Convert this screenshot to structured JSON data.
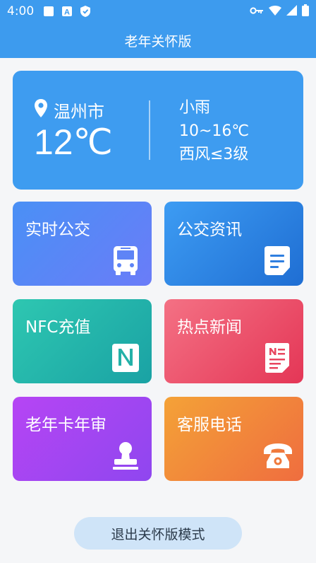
{
  "status_bar": {
    "time": "4:00",
    "icons": [
      "square-icon",
      "a-icon",
      "shield-icon",
      "key-icon",
      "wifi-icon",
      "signal-icon",
      "battery-icon"
    ]
  },
  "header": {
    "title": "老年关怀版"
  },
  "weather": {
    "city": "温州市",
    "temperature": "12℃",
    "condition": "小雨",
    "range": "10~16℃",
    "wind": "西风≤3级"
  },
  "tiles": [
    {
      "label": "实时公交",
      "icon": "bus-icon",
      "color": "#5b86f6"
    },
    {
      "label": "公交资讯",
      "icon": "document-icon",
      "color": "#2f85e5"
    },
    {
      "label": "NFC充值",
      "icon": "nfc-icon",
      "color": "#24b6ab"
    },
    {
      "label": "热点新闻",
      "icon": "news-icon",
      "color": "#ec5270"
    },
    {
      "label": "老年卡年审",
      "icon": "stamp-icon",
      "color": "#a245f1"
    },
    {
      "label": "客服电话",
      "icon": "telephone-icon",
      "color": "#f1853b"
    }
  ],
  "footer": {
    "exit_label": "退出关怀版模式"
  }
}
